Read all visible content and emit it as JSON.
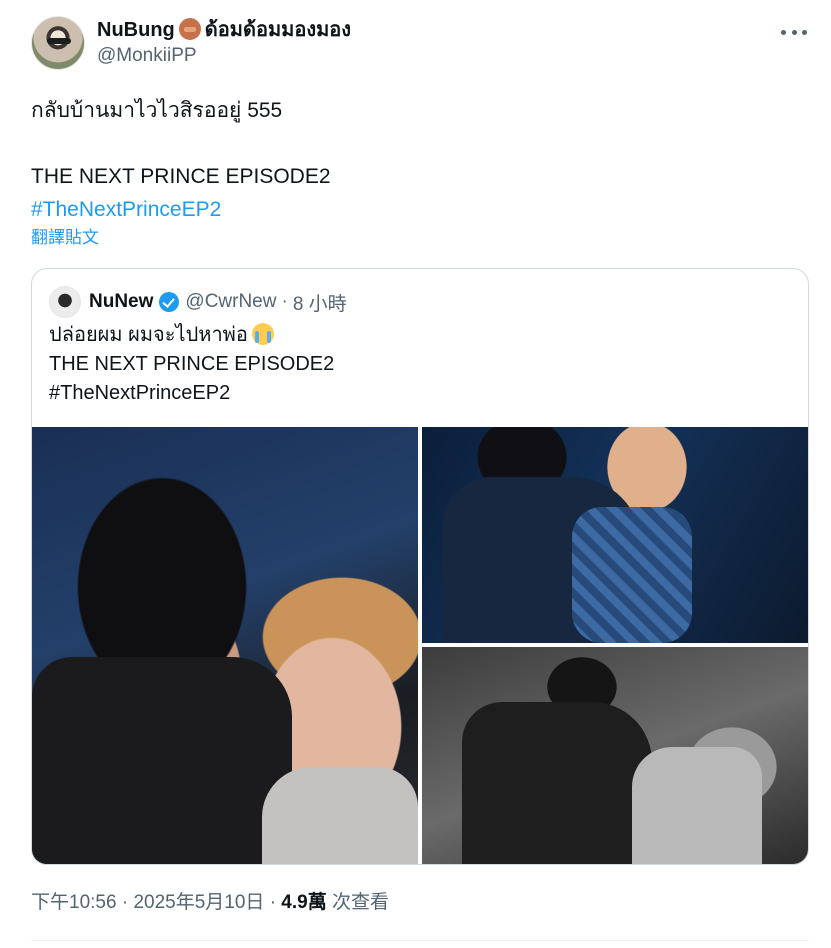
{
  "author": {
    "display_name": "NuBung",
    "display_name_suffix": "ด้อมด้อมมองมอง",
    "handle": "@MonkiiPP",
    "emoji_icon": "see-no-evil-monkey-icon"
  },
  "tweet": {
    "lines": [
      "กลับบ้านมาไวไวสิรออยู่ 555",
      "THE NEXT PRINCE EPISODE2"
    ],
    "hashtag": "#TheNextPrinceEP2",
    "translate_label": "翻譯貼文"
  },
  "quoted": {
    "name": "NuNew",
    "handle": "@CwrNew",
    "separator": "·",
    "time": "8 小時",
    "line1": "ปล่อยผม ผมจะไปหาพ่อ",
    "line2": "THE NEXT PRINCE EPISODE2",
    "line3": "#TheNextPrinceEP2",
    "media_count": 3
  },
  "meta": {
    "time": "下午10:56",
    "separator1": "·",
    "date": "2025年5月10日",
    "separator2": "·",
    "views_count": "4.9萬",
    "views_label": "次查看"
  },
  "colors": {
    "accent": "#1d9bf0",
    "text": "#0f1419",
    "secondary": "#536471",
    "border": "#cfd9de"
  }
}
